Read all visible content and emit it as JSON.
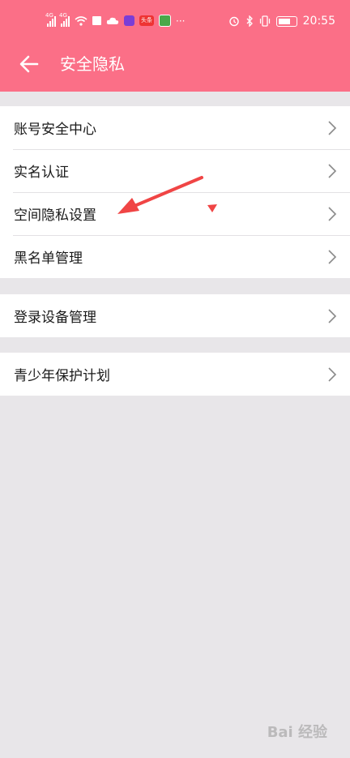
{
  "status_bar": {
    "signal_tag_1": "4G",
    "signal_tag_2": "4G",
    "time": "20:55",
    "app_icon_label": "头条",
    "more": "···"
  },
  "header": {
    "title": "安全隐私"
  },
  "groups": [
    {
      "items": [
        "账号安全中心",
        "实名认证",
        "空间隐私设置",
        "黑名单管理"
      ]
    },
    {
      "items": [
        "登录设备管理"
      ]
    },
    {
      "items": [
        "青少年保护计划"
      ]
    }
  ],
  "colors": {
    "header_bg": "#fb6f87",
    "page_bg": "#e8e6e9",
    "annotation_arrow": "#f04545"
  },
  "watermark": "Bai 经验"
}
